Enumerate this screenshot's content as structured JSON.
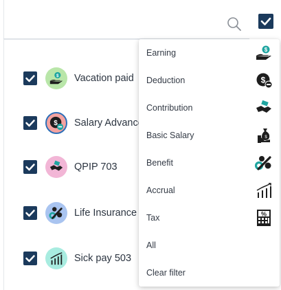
{
  "search": {
    "placeholder": "",
    "value": ""
  },
  "header": {
    "select_all_checked": true
  },
  "items": [
    {
      "label": "Vacation paid",
      "checked": true,
      "icon": "hand-dollar-icon",
      "avatar_color": "#b9e6a9"
    },
    {
      "label": "Salary Advance",
      "checked": true,
      "icon": "dollar-minus-icon",
      "avatar_color": "#f4a3a0"
    },
    {
      "label": "QPIP 703",
      "checked": true,
      "icon": "handshake-money-icon",
      "avatar_color": "#f2b6d6"
    },
    {
      "label": "Life Insurance",
      "checked": true,
      "icon": "percent-icon",
      "avatar_color": "#a9c4f0"
    },
    {
      "label": "Sick pay 503",
      "checked": true,
      "icon": "growth-chart-icon",
      "avatar_color": "#a8ece0"
    }
  ],
  "filter_menu": {
    "options": [
      {
        "label": "Earning",
        "icon": "hand-dollar-icon"
      },
      {
        "label": "Deduction",
        "icon": "dollar-minus-icon"
      },
      {
        "label": "Contribution",
        "icon": "handshake-money-icon"
      },
      {
        "label": "Basic Salary",
        "icon": "money-bag-hand-icon"
      },
      {
        "label": "Benefit",
        "icon": "percent-icon"
      },
      {
        "label": "Accrual",
        "icon": "growth-chart-icon"
      },
      {
        "label": "Tax",
        "icon": "tax-calculator-icon"
      },
      {
        "label": "All",
        "icon": ""
      },
      {
        "label": "Clear filter",
        "icon": ""
      }
    ]
  },
  "colors": {
    "checkbox": "#1b3a5c",
    "teal": "#1fa5a0",
    "dark": "#1e1e1e"
  }
}
